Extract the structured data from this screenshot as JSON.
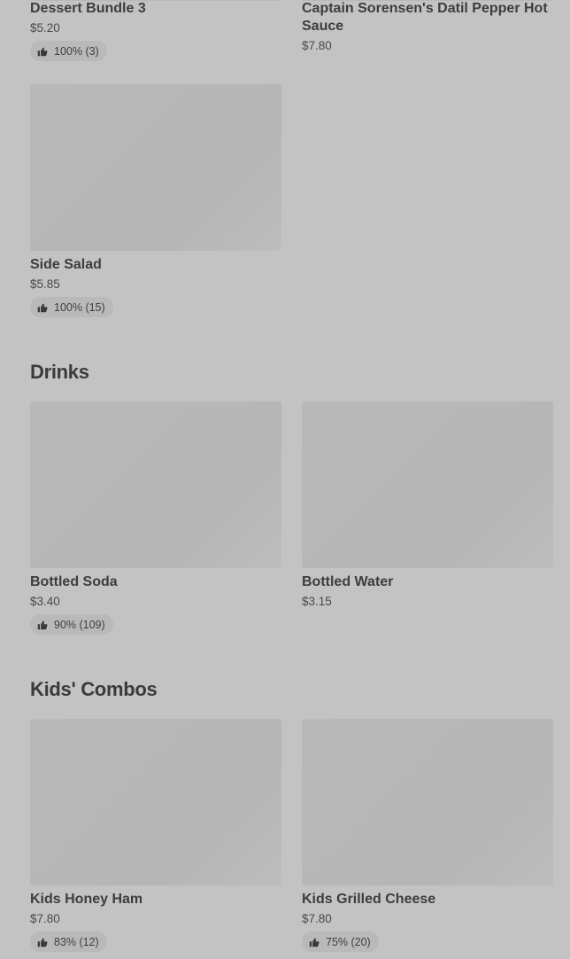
{
  "sections": [
    {
      "items": [
        {
          "name": "Dessert Bundle 3",
          "price": "$5.20",
          "rating": "100% (3)"
        },
        {
          "name": "Captain Sorensen's Datil Pepper Hot Sauce",
          "price": "$7.80"
        },
        {
          "name": "Side Salad",
          "price": "$5.85",
          "rating": "100% (15)"
        }
      ]
    },
    {
      "title": "Drinks",
      "items": [
        {
          "name": "Bottled Soda",
          "price": "$3.40",
          "rating": "90% (109)"
        },
        {
          "name": "Bottled Water",
          "price": "$3.15"
        }
      ]
    },
    {
      "title": "Kids' Combos",
      "items": [
        {
          "name": "Kids Honey Ham",
          "price": "$7.80",
          "rating": "83% (12)"
        },
        {
          "name": "Kids Grilled Cheese",
          "price": "$7.80",
          "rating": "75% (20)"
        }
      ]
    }
  ],
  "icons": {
    "rating": "thumbs-up-icon"
  }
}
